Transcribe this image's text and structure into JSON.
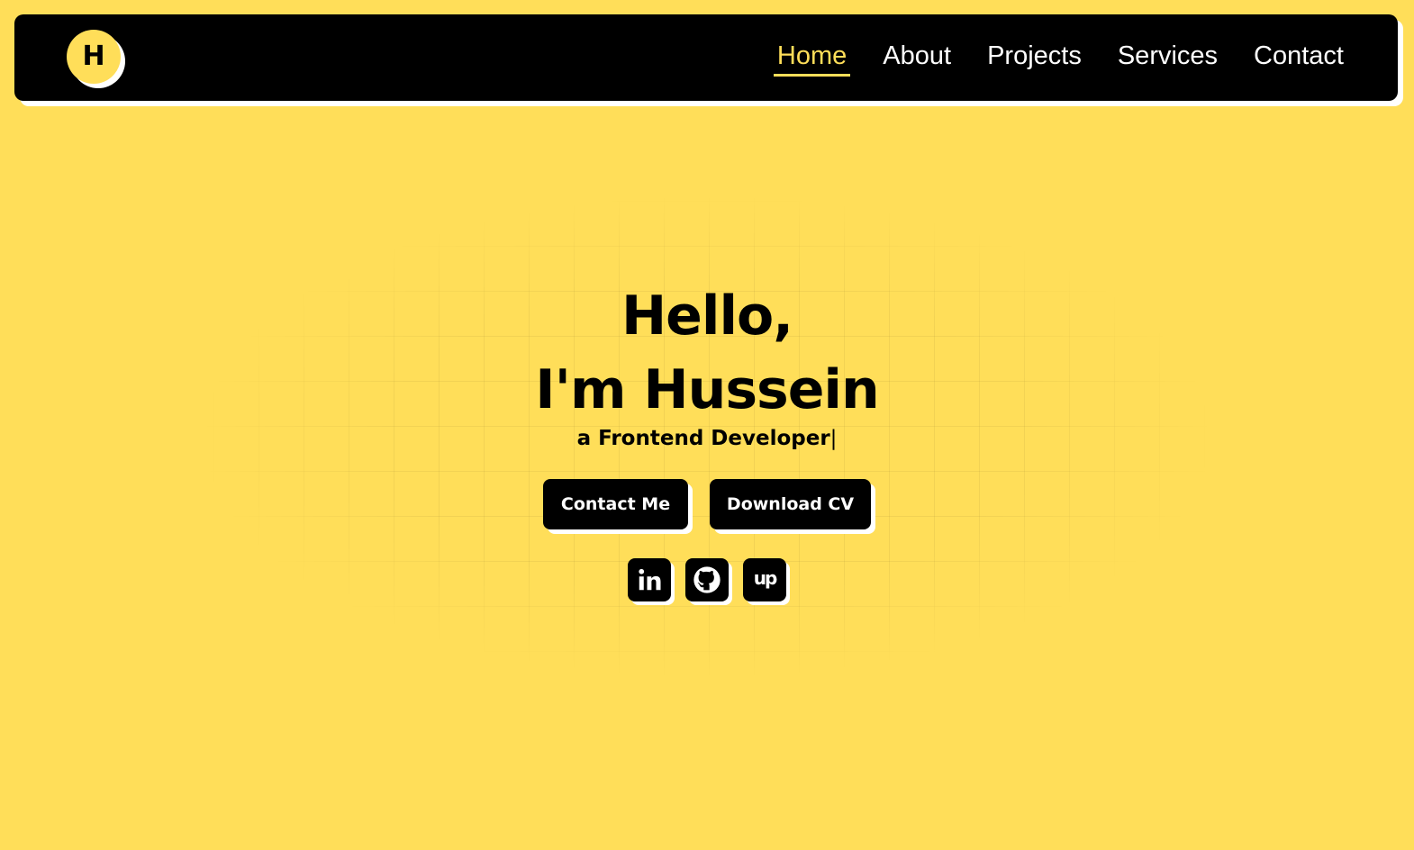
{
  "logo": {
    "letter": "H"
  },
  "nav": {
    "items": [
      {
        "label": "Home",
        "active": true
      },
      {
        "label": "About",
        "active": false
      },
      {
        "label": "Projects",
        "active": false
      },
      {
        "label": "Services",
        "active": false
      },
      {
        "label": "Contact",
        "active": false
      }
    ]
  },
  "hero": {
    "greeting": "Hello,",
    "name_line": "I'm Hussein",
    "subtitle": "a Frontend Developer",
    "cursor": "|"
  },
  "buttons": {
    "contact_label": "Contact Me",
    "cv_label": "Download CV"
  },
  "social": {
    "items": [
      {
        "icon": "linkedin-icon"
      },
      {
        "icon": "github-icon"
      },
      {
        "icon": "upwork-icon",
        "glyph": "up"
      }
    ]
  },
  "colors": {
    "background": "#FFDE59",
    "navbar": "#000000",
    "accent": "#FFDE59",
    "text_light": "#FFFFFF",
    "shadow": "#FFFFFF"
  }
}
